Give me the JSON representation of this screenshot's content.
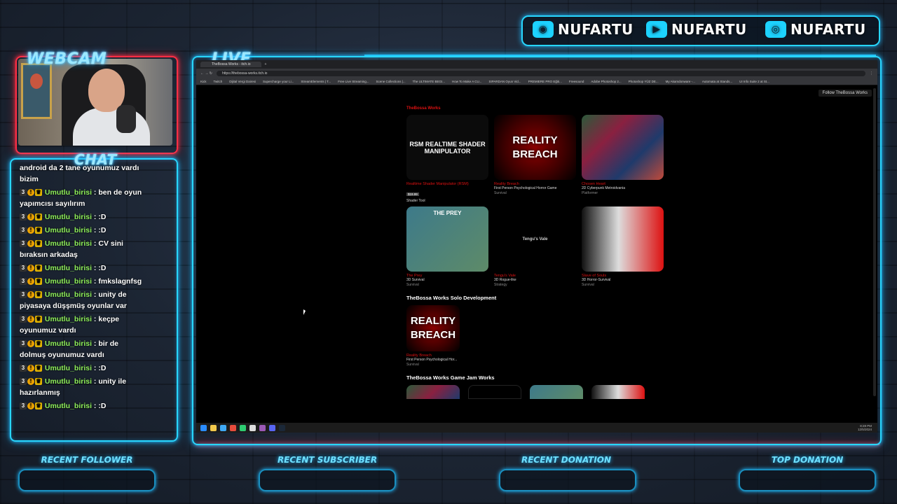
{
  "overlay": {
    "webcam_label": "WEBCAM",
    "live_label": "LIVE",
    "chat_label": "CHAT",
    "accent_color": "#28d7ff",
    "alert_color": "#ff2e44",
    "socials": [
      {
        "platform": "discord",
        "icon": "discord-icon",
        "handle": "NUFARTU"
      },
      {
        "platform": "youtube",
        "icon": "youtube-icon",
        "handle": "NUFARTU"
      },
      {
        "platform": "instagram",
        "icon": "instagram-icon",
        "handle": "NUFARTU"
      }
    ],
    "stats": {
      "recent_follower": "RECENT FOLLOWER",
      "recent_subscriber": "RECENT SUBSCRIBER",
      "recent_donation": "RECENT DONATION",
      "top_donation": "TOP DONATION"
    }
  },
  "chat": {
    "first_line": "android da 2 tane oyunumuz vardı bizim",
    "messages": [
      {
        "badge": "3",
        "user": "Umutlu_birisi",
        "text": "ben de oyun yapımcısı sayılırım"
      },
      {
        "badge": "3",
        "user": "Umutlu_birisi",
        "text": ":D"
      },
      {
        "badge": "3",
        "user": "Umutlu_birisi",
        "text": ":D"
      },
      {
        "badge": "3",
        "user": "Umutlu_birisi",
        "text": "CV sini bıraksın arkadaş"
      },
      {
        "badge": "3",
        "user": "Umutlu_birisi",
        "text": ":D"
      },
      {
        "badge": "3",
        "user": "Umutlu_birisi",
        "text": "fmkslagnfsg"
      },
      {
        "badge": "3",
        "user": "Umutlu_birisi",
        "text": "unity de piyasaya düşşmüş oyunlar var"
      },
      {
        "badge": "3",
        "user": "Umutlu_birisi",
        "text": "keçpe oyunumuz vardı"
      },
      {
        "badge": "3",
        "user": "Umutlu_birisi",
        "text": "bir de dolmuş oyunumuz vardı"
      },
      {
        "badge": "3",
        "user": "Umutlu_birisi",
        "text": ":D"
      },
      {
        "badge": "3",
        "user": "Umutlu_birisi",
        "text": "unity ile hazırlanmış"
      },
      {
        "badge": "3",
        "user": "Umutlu_birisi",
        "text": ":D"
      }
    ]
  },
  "browser": {
    "tab_title": "TheBossa Works - itch.io",
    "url": "https://thebossa-works.itch.io",
    "bookmarks": [
      "Kick",
      "Twitch",
      "Dijital Vergi Dairesi",
      "Supercharge your Li...",
      "StreamElements | T...",
      "Free Live Streaming...",
      "Scene Collections |...",
      "The ULTIMATE BEGI...",
      "How To Make A CU...",
      "SIPARDAN Oyun Vid...",
      "PREMIERE PRO Eğiti...",
      "Freesound",
      "Adobe Photoshop 2...",
      "Photoshop YÜZ DE...",
      "My Akamdonware -...",
      "Automata at Stands...",
      "UI Info Suite 2 at St..."
    ],
    "follow_label": "Follow TheBossa Works",
    "sections": [
      {
        "title": "TheBossa Works",
        "cards": [
          {
            "thumb_text": "RSM REALTIME SHADER MANIPULATOR",
            "thumb_style": "t-shader",
            "title": "Realtime Shader Manipulator (RSM)",
            "price": "$19.99",
            "desc": "Shader Tool",
            "genre": ""
          },
          {
            "thumb_text": "REALITY BREACH",
            "thumb_style": "t-reality",
            "title": "Reality Breach",
            "price": "",
            "desc": "First Person Psychological Horror Game",
            "genre": "Survival"
          },
          {
            "thumb_text": "",
            "thumb_style": "t-chosen",
            "title": "Chosen Heart",
            "price": "",
            "desc": "2D Cyberpunk Metroidvania",
            "genre": "Platformer"
          },
          {
            "thumb_text": "THE PREY",
            "thumb_style": "t-prey",
            "title": "The Prey",
            "price": "",
            "desc": "3D Survival",
            "genre": "Survival"
          },
          {
            "thumb_text": "Tengu's Vale",
            "thumb_style": "t-tengus",
            "title": "Tengu's Vale",
            "price": "",
            "desc": "3D Rogue-like",
            "genre": "Strategy"
          },
          {
            "thumb_text": "",
            "thumb_style": "t-slave",
            "title": "Slave of Souls",
            "price": "",
            "desc": "3D Horror-Survival",
            "genre": "Survival"
          }
        ]
      },
      {
        "title": "TheBossa Works Solo Development",
        "cards": [
          {
            "thumb_text": "REALITY BREACH",
            "thumb_style": "t-reality",
            "title": "Reality Breach",
            "price": "",
            "desc": "First Person Psychological Hor...",
            "genre": "Survival"
          }
        ]
      },
      {
        "title": "TheBossa Works Game Jam Works",
        "cards": []
      }
    ],
    "taskbar_time": "8:28 PM",
    "taskbar_date": "12/5/2024"
  }
}
